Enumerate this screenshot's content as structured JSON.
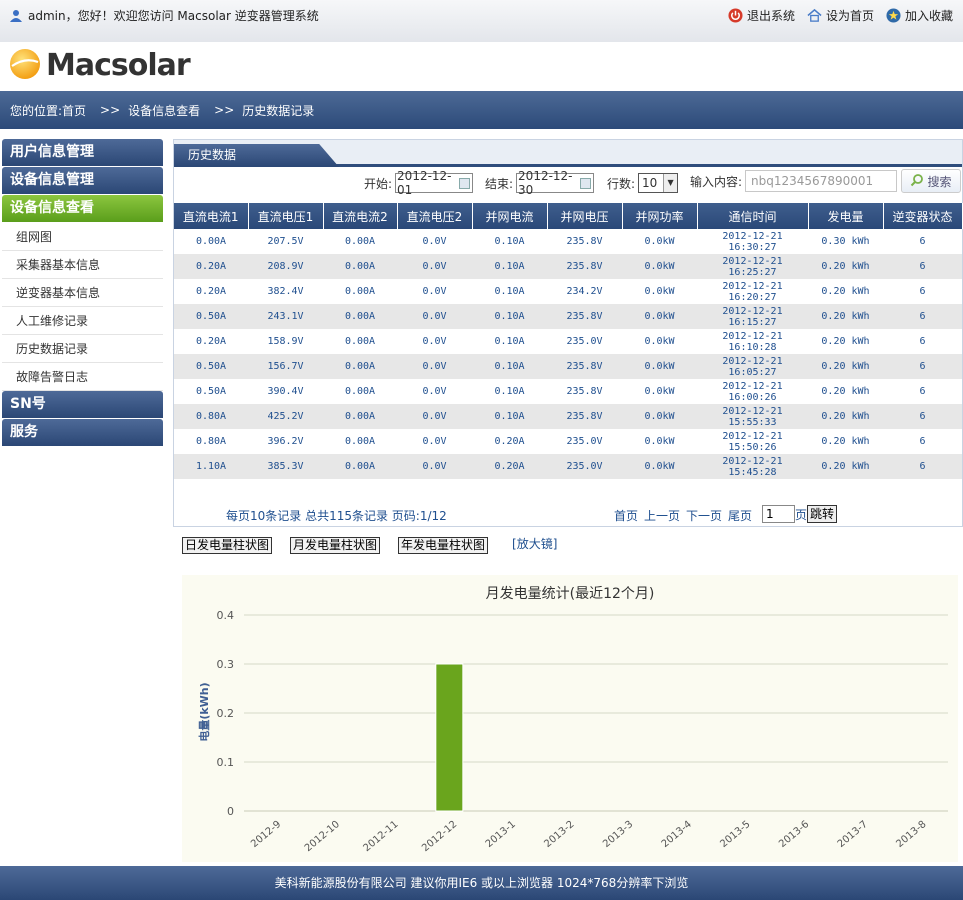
{
  "header": {
    "welcome": "admin，您好！欢迎您访问 Macsolar 逆变器管理系统",
    "logout": "退出系统",
    "set_home": "设为首页",
    "favorite": "加入收藏"
  },
  "logo": {
    "text": "Macsolar"
  },
  "breadcrumb": {
    "prefix": "您的位置:首页",
    "sep": ">>",
    "level2": "设备信息查看",
    "level3": "历史数据记录"
  },
  "sidebar": {
    "heads": [
      "用户信息管理",
      "设备信息管理",
      "设备信息查看"
    ],
    "items": [
      "组网图",
      "采集器基本信息",
      "逆变器基本信息",
      "人工维修记录",
      "历史数据记录",
      "故障告警日志"
    ],
    "heads_bottom": [
      "SN号",
      "服务"
    ]
  },
  "panel": {
    "tab": "历史数据",
    "filters": {
      "start_label": "开始:",
      "start_value": "2012-12-01",
      "end_label": "结束:",
      "end_value": "2012-12-30",
      "rows_label": "行数:",
      "rows_value": "10",
      "input_label": "输入内容:",
      "input_placeholder": "nbq1234567890001",
      "search": "搜索"
    },
    "columns": [
      "直流电流1",
      "直流电压1",
      "直流电流2",
      "直流电压2",
      "并网电流",
      "并网电压",
      "并网功率",
      "通信时间",
      "发电量",
      "逆变器状态"
    ],
    "rows": [
      [
        "0.00A",
        "207.5V",
        "0.00A",
        "0.0V",
        "0.10A",
        "235.8V",
        "0.0kW",
        "2012-12-21 16:30:27",
        "0.30 kWh",
        "6"
      ],
      [
        "0.20A",
        "208.9V",
        "0.00A",
        "0.0V",
        "0.10A",
        "235.8V",
        "0.0kW",
        "2012-12-21 16:25:27",
        "0.20 kWh",
        "6"
      ],
      [
        "0.20A",
        "382.4V",
        "0.00A",
        "0.0V",
        "0.10A",
        "234.2V",
        "0.0kW",
        "2012-12-21 16:20:27",
        "0.20 kWh",
        "6"
      ],
      [
        "0.50A",
        "243.1V",
        "0.00A",
        "0.0V",
        "0.10A",
        "235.8V",
        "0.0kW",
        "2012-12-21 16:15:27",
        "0.20 kWh",
        "6"
      ],
      [
        "0.20A",
        "158.9V",
        "0.00A",
        "0.0V",
        "0.10A",
        "235.0V",
        "0.0kW",
        "2012-12-21 16:10:28",
        "0.20 kWh",
        "6"
      ],
      [
        "0.50A",
        "156.7V",
        "0.00A",
        "0.0V",
        "0.10A",
        "235.8V",
        "0.0kW",
        "2012-12-21 16:05:27",
        "0.20 kWh",
        "6"
      ],
      [
        "0.50A",
        "390.4V",
        "0.00A",
        "0.0V",
        "0.10A",
        "235.8V",
        "0.0kW",
        "2012-12-21 16:00:26",
        "0.20 kWh",
        "6"
      ],
      [
        "0.80A",
        "425.2V",
        "0.00A",
        "0.0V",
        "0.10A",
        "235.8V",
        "0.0kW",
        "2012-12-21 15:55:33",
        "0.20 kWh",
        "6"
      ],
      [
        "0.80A",
        "396.2V",
        "0.00A",
        "0.0V",
        "0.20A",
        "235.0V",
        "0.0kW",
        "2012-12-21 15:50:26",
        "0.20 kWh",
        "6"
      ],
      [
        "1.10A",
        "385.3V",
        "0.00A",
        "0.0V",
        "0.20A",
        "235.0V",
        "0.0kW",
        "2012-12-21 15:45:28",
        "0.20 kWh",
        "6"
      ]
    ],
    "pager": {
      "info": "每页10条记录 总共115条记录 页码:1/12",
      "first": "首页",
      "prev": "上一页",
      "next": "下一页",
      "last": "尾页",
      "page_value": "1",
      "page_suffix": "页",
      "jump": "跳转"
    }
  },
  "chart_buttons": {
    "daily": "日发电量柱状图",
    "monthly": "月发电量柱状图",
    "yearly": "年发电量柱状图",
    "zoom": "[放大镜]"
  },
  "chart_data": {
    "type": "bar",
    "title": "月发电量统计(最近12个月)",
    "ylabel": "电量(kWh)",
    "xlabel": "",
    "categories": [
      "2012-9",
      "2012-10",
      "2012-11",
      "2012-12",
      "2013-1",
      "2013-2",
      "2013-3",
      "2013-4",
      "2013-5",
      "2013-6",
      "2013-7",
      "2013-8"
    ],
    "values": [
      0,
      0,
      0,
      0.3,
      0,
      0,
      0,
      0,
      0,
      0,
      0,
      0
    ],
    "ylim": [
      0,
      0.4
    ],
    "yticks": [
      0,
      0.1,
      0.2,
      0.3,
      0.4
    ],
    "ytick_labels": [
      "0",
      "0.1",
      "0.2",
      "0.3",
      "0.4"
    ],
    "grid": true,
    "bar_color": "#6aa51d"
  },
  "footer": {
    "text": "美科新能源股份有限公司 建议你用IE6 或以上浏览器 1024*768分辨率下浏览"
  },
  "colors": {
    "nav_blue": "#2c4a79",
    "active_green": "#6aa51d",
    "link_blue": "#1f4f8f"
  }
}
